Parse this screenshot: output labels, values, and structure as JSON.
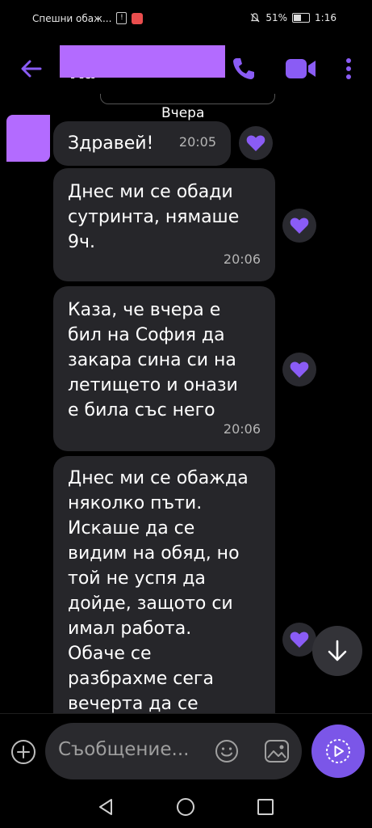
{
  "status_bar": {
    "notification_text": "Спешни обаж...",
    "battery": "51%",
    "time": "1:16"
  },
  "header": {
    "contact_name": "Ка"
  },
  "chat": {
    "date_separator": "Вчера",
    "messages": [
      {
        "text": "Здравей!",
        "time": "20:05"
      },
      {
        "lines": [
          "Днес ми се обади",
          "сутринта, нямаше",
          "9ч."
        ],
        "time": "20:06"
      },
      {
        "lines": [
          "Каза, че вчера е",
          "бил на София да",
          "закара сина си на",
          "летището и онази",
          "е била със него"
        ],
        "time": "20:06"
      },
      {
        "lines": [
          "Днес ми се обажда",
          "няколко пъти.",
          "Искаше да се",
          "видим на обяд, но",
          "той не успя да",
          "дойде, защото си",
          "имал работа.",
          "Обаче се",
          "разбрахме сега",
          "вечерта да се"
        ]
      }
    ]
  },
  "composer": {
    "placeholder": "Съобщение..."
  },
  "colors": {
    "accent": "#7b56e8",
    "heart": "#8a5cf5",
    "bubble": "#26262a"
  }
}
